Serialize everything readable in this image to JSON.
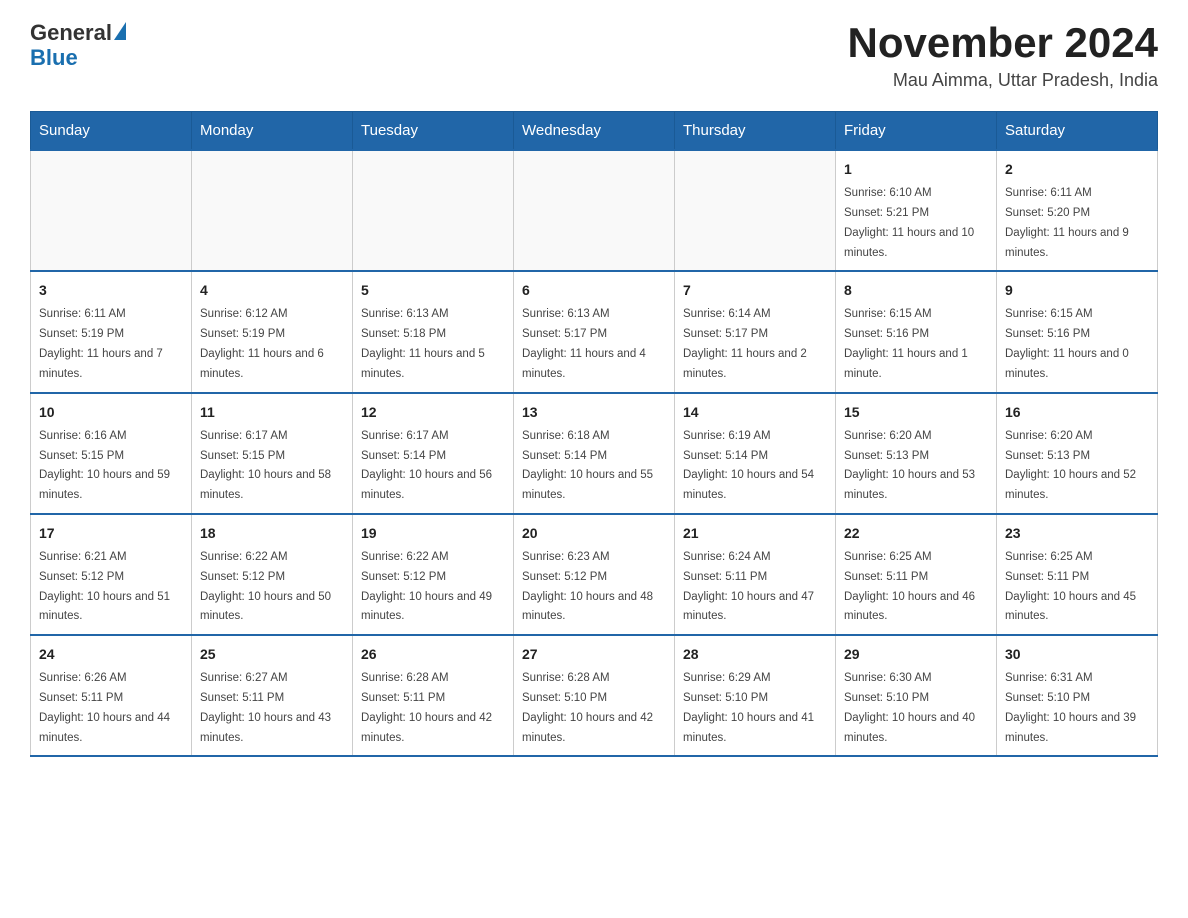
{
  "header": {
    "logo_general": "General",
    "logo_blue": "Blue",
    "month_title": "November 2024",
    "subtitle": "Mau Aimma, Uttar Pradesh, India"
  },
  "days_of_week": [
    "Sunday",
    "Monday",
    "Tuesday",
    "Wednesday",
    "Thursday",
    "Friday",
    "Saturday"
  ],
  "weeks": [
    [
      {
        "day": "",
        "info": ""
      },
      {
        "day": "",
        "info": ""
      },
      {
        "day": "",
        "info": ""
      },
      {
        "day": "",
        "info": ""
      },
      {
        "day": "",
        "info": ""
      },
      {
        "day": "1",
        "info": "Sunrise: 6:10 AM\nSunset: 5:21 PM\nDaylight: 11 hours and 10 minutes."
      },
      {
        "day": "2",
        "info": "Sunrise: 6:11 AM\nSunset: 5:20 PM\nDaylight: 11 hours and 9 minutes."
      }
    ],
    [
      {
        "day": "3",
        "info": "Sunrise: 6:11 AM\nSunset: 5:19 PM\nDaylight: 11 hours and 7 minutes."
      },
      {
        "day": "4",
        "info": "Sunrise: 6:12 AM\nSunset: 5:19 PM\nDaylight: 11 hours and 6 minutes."
      },
      {
        "day": "5",
        "info": "Sunrise: 6:13 AM\nSunset: 5:18 PM\nDaylight: 11 hours and 5 minutes."
      },
      {
        "day": "6",
        "info": "Sunrise: 6:13 AM\nSunset: 5:17 PM\nDaylight: 11 hours and 4 minutes."
      },
      {
        "day": "7",
        "info": "Sunrise: 6:14 AM\nSunset: 5:17 PM\nDaylight: 11 hours and 2 minutes."
      },
      {
        "day": "8",
        "info": "Sunrise: 6:15 AM\nSunset: 5:16 PM\nDaylight: 11 hours and 1 minute."
      },
      {
        "day": "9",
        "info": "Sunrise: 6:15 AM\nSunset: 5:16 PM\nDaylight: 11 hours and 0 minutes."
      }
    ],
    [
      {
        "day": "10",
        "info": "Sunrise: 6:16 AM\nSunset: 5:15 PM\nDaylight: 10 hours and 59 minutes."
      },
      {
        "day": "11",
        "info": "Sunrise: 6:17 AM\nSunset: 5:15 PM\nDaylight: 10 hours and 58 minutes."
      },
      {
        "day": "12",
        "info": "Sunrise: 6:17 AM\nSunset: 5:14 PM\nDaylight: 10 hours and 56 minutes."
      },
      {
        "day": "13",
        "info": "Sunrise: 6:18 AM\nSunset: 5:14 PM\nDaylight: 10 hours and 55 minutes."
      },
      {
        "day": "14",
        "info": "Sunrise: 6:19 AM\nSunset: 5:14 PM\nDaylight: 10 hours and 54 minutes."
      },
      {
        "day": "15",
        "info": "Sunrise: 6:20 AM\nSunset: 5:13 PM\nDaylight: 10 hours and 53 minutes."
      },
      {
        "day": "16",
        "info": "Sunrise: 6:20 AM\nSunset: 5:13 PM\nDaylight: 10 hours and 52 minutes."
      }
    ],
    [
      {
        "day": "17",
        "info": "Sunrise: 6:21 AM\nSunset: 5:12 PM\nDaylight: 10 hours and 51 minutes."
      },
      {
        "day": "18",
        "info": "Sunrise: 6:22 AM\nSunset: 5:12 PM\nDaylight: 10 hours and 50 minutes."
      },
      {
        "day": "19",
        "info": "Sunrise: 6:22 AM\nSunset: 5:12 PM\nDaylight: 10 hours and 49 minutes."
      },
      {
        "day": "20",
        "info": "Sunrise: 6:23 AM\nSunset: 5:12 PM\nDaylight: 10 hours and 48 minutes."
      },
      {
        "day": "21",
        "info": "Sunrise: 6:24 AM\nSunset: 5:11 PM\nDaylight: 10 hours and 47 minutes."
      },
      {
        "day": "22",
        "info": "Sunrise: 6:25 AM\nSunset: 5:11 PM\nDaylight: 10 hours and 46 minutes."
      },
      {
        "day": "23",
        "info": "Sunrise: 6:25 AM\nSunset: 5:11 PM\nDaylight: 10 hours and 45 minutes."
      }
    ],
    [
      {
        "day": "24",
        "info": "Sunrise: 6:26 AM\nSunset: 5:11 PM\nDaylight: 10 hours and 44 minutes."
      },
      {
        "day": "25",
        "info": "Sunrise: 6:27 AM\nSunset: 5:11 PM\nDaylight: 10 hours and 43 minutes."
      },
      {
        "day": "26",
        "info": "Sunrise: 6:28 AM\nSunset: 5:11 PM\nDaylight: 10 hours and 42 minutes."
      },
      {
        "day": "27",
        "info": "Sunrise: 6:28 AM\nSunset: 5:10 PM\nDaylight: 10 hours and 42 minutes."
      },
      {
        "day": "28",
        "info": "Sunrise: 6:29 AM\nSunset: 5:10 PM\nDaylight: 10 hours and 41 minutes."
      },
      {
        "day": "29",
        "info": "Sunrise: 6:30 AM\nSunset: 5:10 PM\nDaylight: 10 hours and 40 minutes."
      },
      {
        "day": "30",
        "info": "Sunrise: 6:31 AM\nSunset: 5:10 PM\nDaylight: 10 hours and 39 minutes."
      }
    ]
  ]
}
